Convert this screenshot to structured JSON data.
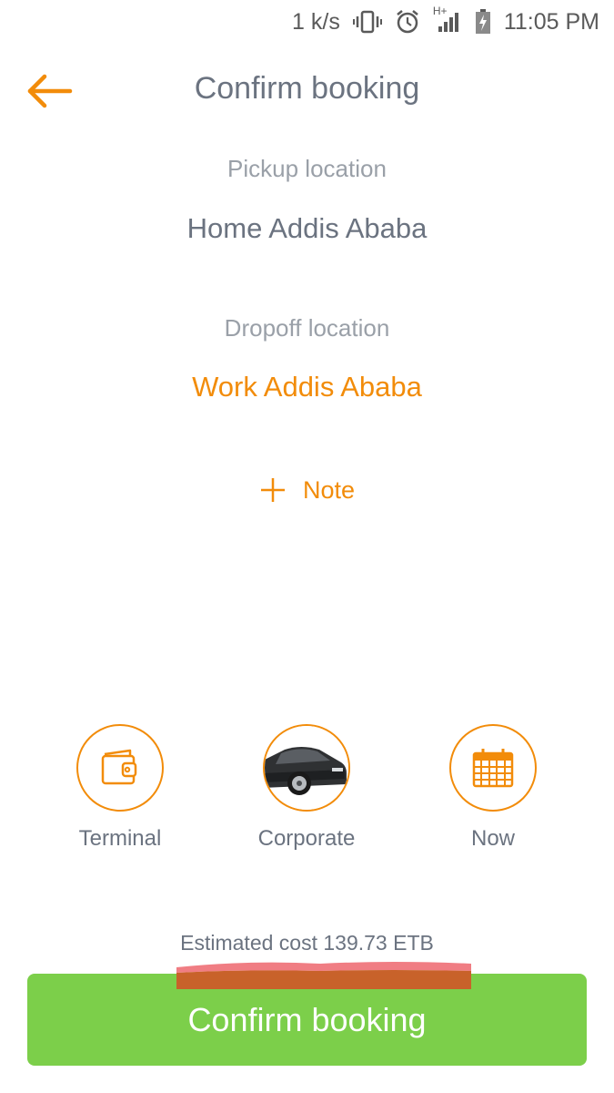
{
  "status_bar": {
    "speed": "1 k/s",
    "network": "H+",
    "time": "11:05 PM",
    "icons": [
      "vibrate-icon",
      "alarm-icon",
      "signal-icon",
      "battery-charging-icon"
    ]
  },
  "header": {
    "back_icon": "back-arrow-icon",
    "title": "Confirm booking"
  },
  "pickup": {
    "label": "Pickup location",
    "value": "Home Addis Ababa"
  },
  "dropoff": {
    "label": "Dropoff location",
    "value": "Work Addis Ababa"
  },
  "note": {
    "icon": "plus-icon",
    "label": "Note"
  },
  "options": [
    {
      "icon": "wallet-icon",
      "label": "Terminal"
    },
    {
      "icon": "car-icon",
      "label": "Corporate"
    },
    {
      "icon": "calendar-icon",
      "label": "Now"
    }
  ],
  "estimate": {
    "text": "Estimated cost 139.73 ETB"
  },
  "confirm": {
    "label": "Confirm booking"
  },
  "colors": {
    "accent": "#f28c0a",
    "confirm_bg": "#7ccf4a",
    "text_gray": "#6b7380",
    "label_gray": "#9aa0a8"
  }
}
